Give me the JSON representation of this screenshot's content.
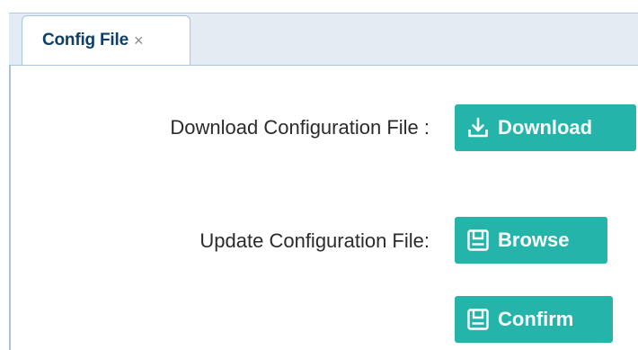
{
  "tabs": [
    {
      "label": "Config File",
      "close": "×"
    }
  ],
  "download": {
    "label": "Download Configuration File :",
    "button": "Download",
    "icon": "download-icon"
  },
  "update": {
    "label": "Update Configuration File:",
    "browse_button": "Browse",
    "browse_icon": "save-icon",
    "confirm_button": "Confirm",
    "confirm_icon": "save-icon"
  },
  "colors": {
    "button_bg": "#25b4a9",
    "tab_text": "#0e3e6a",
    "tab_strip_bg": "#e4ebf3",
    "border": "#a9c4dd"
  }
}
